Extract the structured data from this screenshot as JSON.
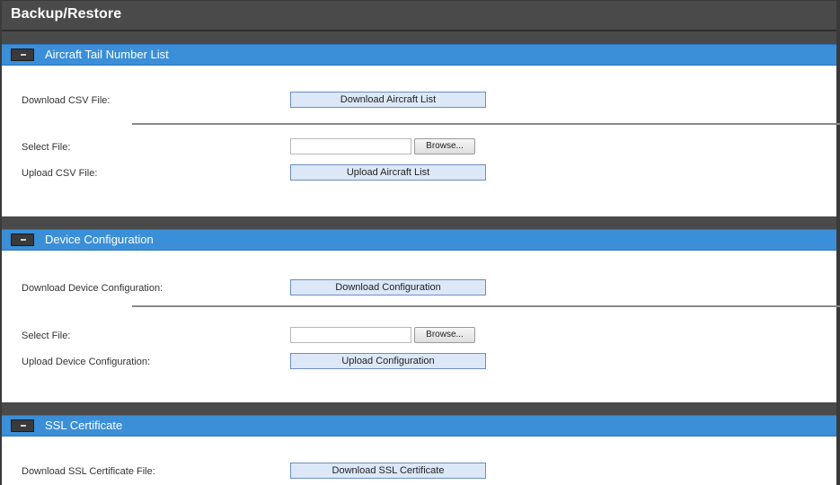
{
  "page": {
    "title": "Backup/Restore"
  },
  "sections": [
    {
      "title": "Aircraft Tail Number List",
      "download_label": "Download CSV File:",
      "download_button": "Download Aircraft List",
      "select_label": "Select File:",
      "browse_button": "Browse...",
      "upload_label": "Upload CSV File:",
      "upload_button": "Upload Aircraft List"
    },
    {
      "title": "Device Configuration",
      "download_label": "Download Device Configuration:",
      "download_button": "Download Configuration",
      "select_label": "Select File:",
      "browse_button": "Browse...",
      "upload_label": "Upload Device Configuration:",
      "upload_button": "Upload Configuration"
    },
    {
      "title": "SSL Certificate",
      "download_label": "Download SSL Certificate File:",
      "download_button": "Download SSL Certificate"
    }
  ]
}
